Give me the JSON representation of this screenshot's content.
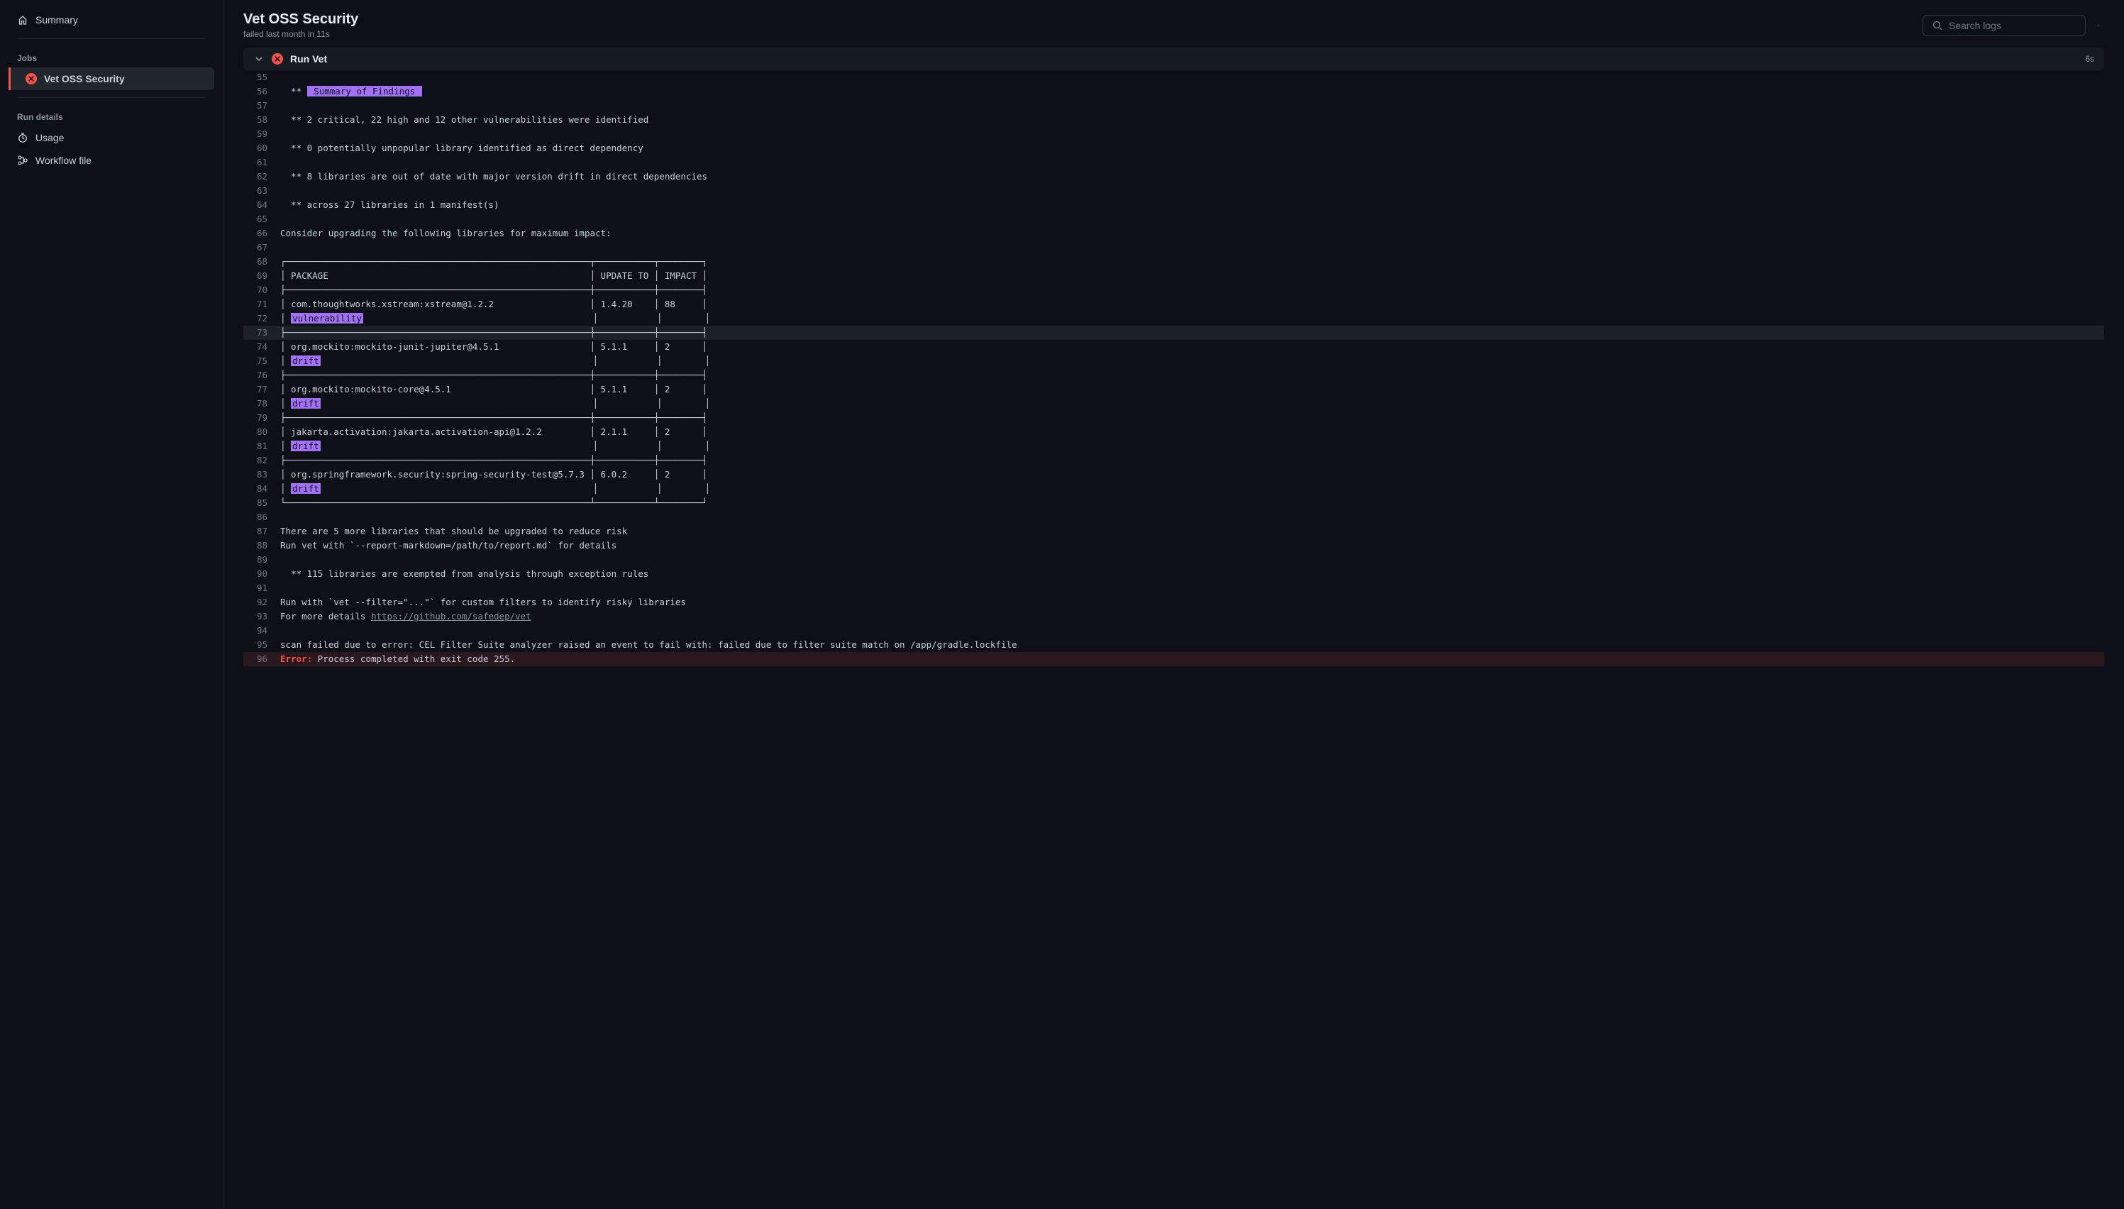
{
  "sidebar": {
    "summary_label": "Summary",
    "jobs_heading": "Jobs",
    "job_name": "Vet OSS Security",
    "run_details_heading": "Run details",
    "usage_label": "Usage",
    "workflow_file_label": "Workflow file"
  },
  "header": {
    "title": "Vet OSS Security",
    "subtitle": "failed last month in 11s"
  },
  "search": {
    "placeholder": "Search logs"
  },
  "step": {
    "title": "Run Vet",
    "duration": "6s"
  },
  "log": [
    {
      "n": 55,
      "t": ""
    },
    {
      "n": 56,
      "pre": "  ** ",
      "box": " Summary of Findings "
    },
    {
      "n": 57,
      "t": ""
    },
    {
      "n": 58,
      "t": "  ** 2 critical, 22 high and 12 other vulnerabilities were identified"
    },
    {
      "n": 59,
      "t": ""
    },
    {
      "n": 60,
      "t": "  ** 0 potentially unpopular library identified as direct dependency"
    },
    {
      "n": 61,
      "t": ""
    },
    {
      "n": 62,
      "t": "  ** 8 libraries are out of date with major version drift in direct dependencies"
    },
    {
      "n": 63,
      "t": ""
    },
    {
      "n": 64,
      "t": "  ** across 27 libraries in 1 manifest(s)"
    },
    {
      "n": 65,
      "t": ""
    },
    {
      "n": 66,
      "t": "Consider upgrading the following libraries for maximum impact:"
    },
    {
      "n": 67,
      "t": ""
    },
    {
      "n": 68,
      "t": "┌─────────────────────────────────────────────────────────┬───────────┬────────┐"
    },
    {
      "n": 69,
      "t": "│ PACKAGE                                                 │ UPDATE TO │ IMPACT │"
    },
    {
      "n": 70,
      "t": "├─────────────────────────────────────────────────────────┼───────────┼────────┤"
    },
    {
      "n": 71,
      "t": "│ com.thoughtworks.xstream:xstream@1.2.2                  │ 1.4.20    │ 88     │"
    },
    {
      "n": 72,
      "pre": "│ ",
      "box": "vulnerability",
      "post": "                                           │           │        │"
    },
    {
      "n": 73,
      "t": "├─────────────────────────────────────────────────────────┼───────────┼────────┤",
      "hl": true
    },
    {
      "n": 74,
      "t": "│ org.mockito:mockito-junit-jupiter@4.5.1                 │ 5.1.1     │ 2      │"
    },
    {
      "n": 75,
      "pre": "│ ",
      "box": "drift",
      "post": "                                                   │           │        │"
    },
    {
      "n": 76,
      "t": "├─────────────────────────────────────────────────────────┼───────────┼────────┤"
    },
    {
      "n": 77,
      "t": "│ org.mockito:mockito-core@4.5.1                          │ 5.1.1     │ 2      │"
    },
    {
      "n": 78,
      "pre": "│ ",
      "box": "drift",
      "post": "                                                   │           │        │"
    },
    {
      "n": 79,
      "t": "├─────────────────────────────────────────────────────────┼───────────┼────────┤"
    },
    {
      "n": 80,
      "t": "│ jakarta.activation:jakarta.activation-api@1.2.2         │ 2.1.1     │ 2      │"
    },
    {
      "n": 81,
      "pre": "│ ",
      "box": "drift",
      "post": "                                                   │           │        │"
    },
    {
      "n": 82,
      "t": "├─────────────────────────────────────────────────────────┼───────────┼────────┤"
    },
    {
      "n": 83,
      "t": "│ org.springframework.security:spring-security-test@5.7.3 │ 6.0.2     │ 2      │"
    },
    {
      "n": 84,
      "pre": "│ ",
      "box": "drift",
      "post": "                                                   │           │        │"
    },
    {
      "n": 85,
      "t": "└─────────────────────────────────────────────────────────┴───────────┴────────┘"
    },
    {
      "n": 86,
      "t": ""
    },
    {
      "n": 87,
      "t": "There are 5 more libraries that should be upgraded to reduce risk"
    },
    {
      "n": 88,
      "t": "Run vet with `--report-markdown=/path/to/report.md` for details"
    },
    {
      "n": 89,
      "t": ""
    },
    {
      "n": 90,
      "t": "  ** 115 libraries are exempted from analysis through exception rules"
    },
    {
      "n": 91,
      "t": ""
    },
    {
      "n": 92,
      "t": "Run with `vet --filter=\"...\"` for custom filters to identify risky libraries"
    },
    {
      "n": 93,
      "pre": "For more details ",
      "link": "https://github.com/safedep/vet"
    },
    {
      "n": 94,
      "t": ""
    },
    {
      "n": 95,
      "t": "scan failed due to error: CEL Filter Suite analyzer raised an event to fail with: failed due to filter suite match on /app/gradle.lockfile"
    },
    {
      "n": 96,
      "err": true,
      "errlabel": "Error:",
      "post": " Process completed with exit code 255."
    }
  ]
}
